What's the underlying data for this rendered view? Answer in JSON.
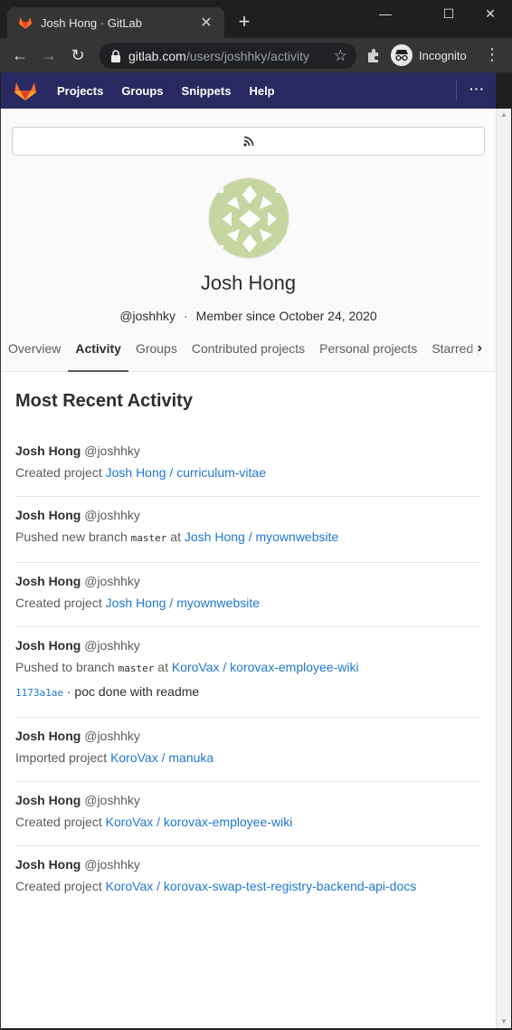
{
  "browser": {
    "tab_title": "Josh Hong · GitLab",
    "url_host": "gitlab.com",
    "url_path": "/users/joshhky/activity",
    "incognito_label": "Incognito"
  },
  "gitlab_nav": {
    "items": [
      "Projects",
      "Groups",
      "Snippets",
      "Help"
    ]
  },
  "profile": {
    "name": "Josh Hong",
    "handle": "@joshhky",
    "member_since": "Member since October 24, 2020",
    "tabs": [
      "Overview",
      "Activity",
      "Groups",
      "Contributed projects",
      "Personal projects",
      "Starred projects"
    ],
    "active_tab": "Activity"
  },
  "activity": {
    "heading": "Most Recent Activity",
    "events": [
      {
        "author": "Josh Hong",
        "handle": "@joshhky",
        "action": "Created project",
        "target": "Josh Hong / curriculum-vitae"
      },
      {
        "author": "Josh Hong",
        "handle": "@joshhky",
        "action": "Pushed new branch",
        "branch": "master",
        "at": "at",
        "target": "Josh Hong / myownwebsite"
      },
      {
        "author": "Josh Hong",
        "handle": "@joshhky",
        "action": "Created project",
        "target": "Josh Hong / myownwebsite"
      },
      {
        "author": "Josh Hong",
        "handle": "@joshhky",
        "action": "Pushed to branch",
        "branch": "master",
        "at": "at",
        "target": "KoroVax / korovax-employee-wiki",
        "commit_sha": "1173a1ae",
        "commit_message": "· poc done with readme"
      },
      {
        "author": "Josh Hong",
        "handle": "@joshhky",
        "action": "Imported project",
        "target": "KoroVax / manuka"
      },
      {
        "author": "Josh Hong",
        "handle": "@joshhky",
        "action": "Created project",
        "target": "KoroVax / korovax-employee-wiki"
      },
      {
        "author": "Josh Hong",
        "handle": "@joshhky",
        "action": "Created project",
        "target": "KoroVax / korovax-swap-test-registry-backend-api-docs"
      }
    ]
  },
  "colors": {
    "gitlab_header": "#292961",
    "link": "#1f78d1",
    "avatar_green": "#c5d6a0"
  },
  "icons": [
    "gitlab-logo-icon",
    "rss-icon",
    "lock-icon",
    "star-icon",
    "extensions-icon",
    "incognito-icon"
  ]
}
